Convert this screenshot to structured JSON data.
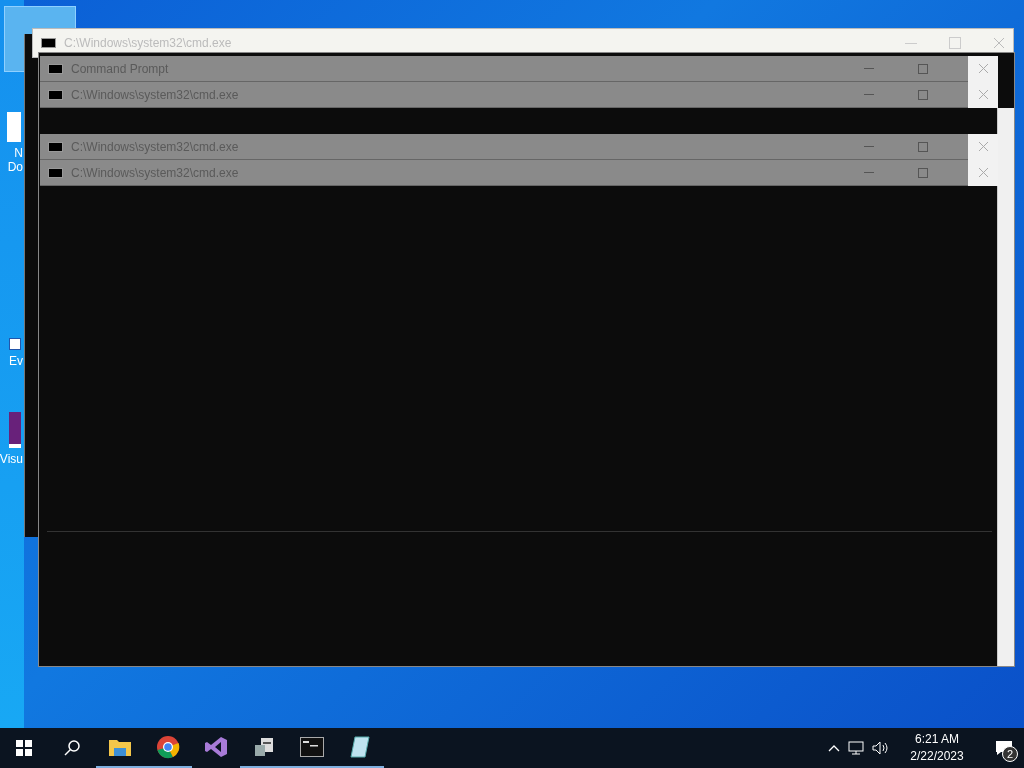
{
  "desktop_icons": [
    {
      "kind": "document",
      "lines": [
        "N",
        "Do"
      ]
    },
    {
      "kind": "shortcut",
      "lines": [
        "Ev"
      ]
    },
    {
      "kind": "studio",
      "lines": [
        "Visu"
      ]
    }
  ],
  "windows": [
    {
      "title": "C:\\Windows\\system32\\cmd.exe"
    },
    {
      "title": "Command Prompt"
    },
    {
      "title": "C:\\Windows\\system32\\cmd.exe"
    },
    {
      "title": "C:\\Windows\\system32\\cmd.exe"
    },
    {
      "title": "C:\\Windows\\system32\\cmd.exe"
    }
  ],
  "taskbar": {
    "items": [
      {
        "kind": "explorer",
        "running": true
      },
      {
        "kind": "chrome",
        "running": true
      },
      {
        "kind": "studio",
        "running": false
      },
      {
        "kind": "server",
        "running": true
      },
      {
        "kind": "console",
        "running": true
      },
      {
        "kind": "notepad",
        "running": true
      }
    ],
    "time": "6:21 AM",
    "date": "2/22/2023",
    "notifications": "2"
  }
}
